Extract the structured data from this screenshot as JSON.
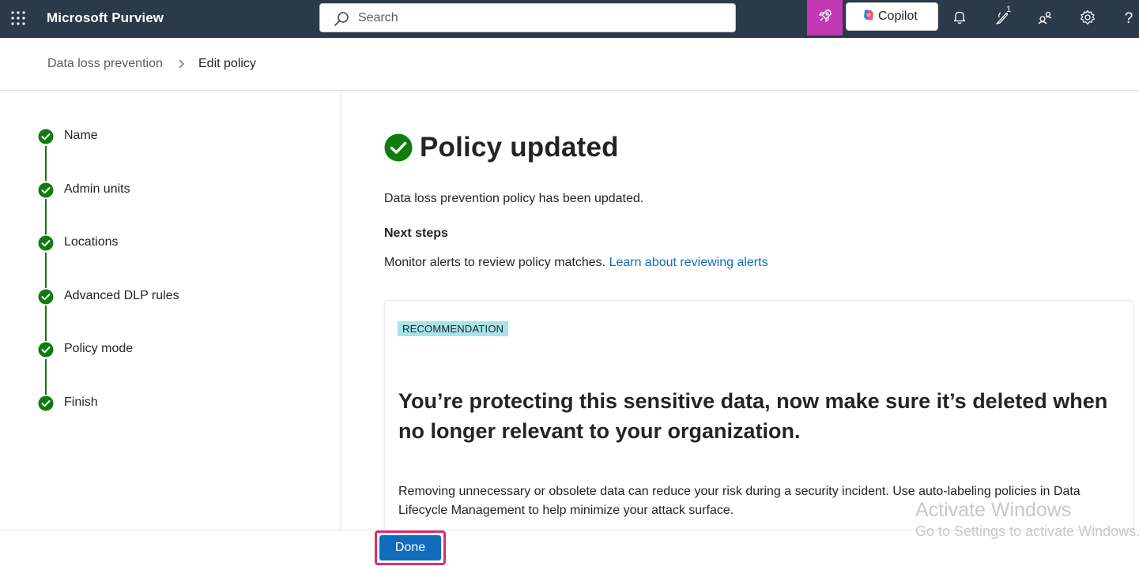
{
  "header": {
    "app_title": "Microsoft Purview",
    "search_placeholder": "Search",
    "copilot_label": "Copilot",
    "notification_count": "1",
    "help_label": "?",
    "accent_color": "#c239b3",
    "bar_color": "#2b3a4a",
    "icons": [
      "waffle-icon",
      "search-icon",
      "rocket-icon",
      "copilot-icon",
      "bell-icon",
      "feedback-icon",
      "share-icon",
      "gear-icon",
      "help-icon"
    ]
  },
  "breadcrumb": {
    "parent": "Data loss prevention",
    "current": "Edit policy"
  },
  "steps": [
    {
      "label": "Name",
      "status": "complete"
    },
    {
      "label": "Admin units",
      "status": "complete"
    },
    {
      "label": "Locations",
      "status": "complete"
    },
    {
      "label": "Advanced DLP rules",
      "status": "complete"
    },
    {
      "label": "Policy mode",
      "status": "complete"
    },
    {
      "label": "Finish",
      "status": "complete"
    }
  ],
  "main": {
    "title": "Policy updated",
    "description": "Data loss prevention policy has been updated.",
    "next_steps_title": "Next steps",
    "next_steps_text": "Monitor alerts to review policy matches.",
    "next_steps_link": "Learn about reviewing alerts"
  },
  "recommendation": {
    "tag": "RECOMMENDATION",
    "title": "You’re protecting this sensitive data, now make sure it’s deleted when no longer relevant to your organization.",
    "body": "Removing unnecessary or obsolete data can reduce your risk during a security incident. Use auto-labeling policies in Data Lifecycle Management to help minimize your attack surface."
  },
  "footer": {
    "done_label": "Done"
  },
  "watermark": {
    "line1": "Activate Windows",
    "line2": "Go to Settings to activate Windows."
  },
  "colors": {
    "success": "#107c10",
    "link": "#0f6cbd",
    "primary_button": "#0f6cbd",
    "highlight_outline": "#e02c6b",
    "tag_background": "#a7e3ec"
  }
}
